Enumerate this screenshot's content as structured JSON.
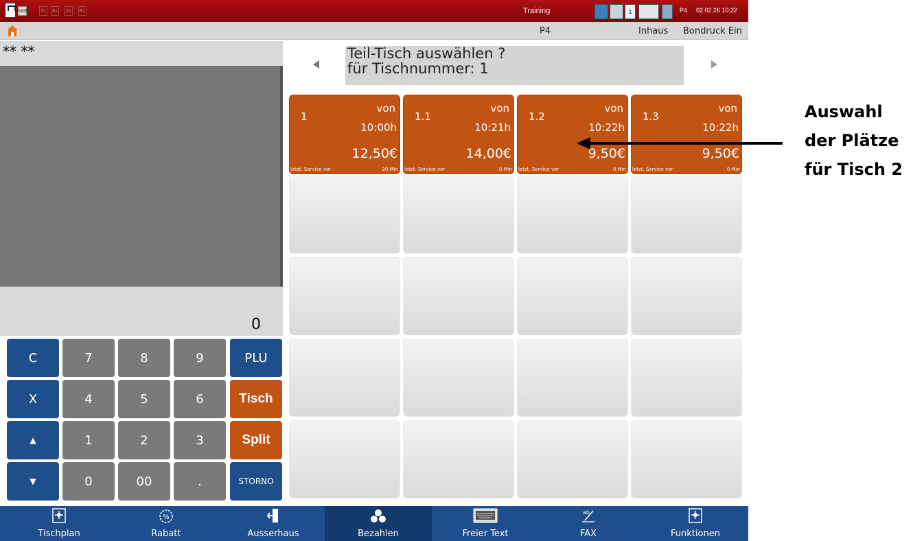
{
  "topbar": {
    "mini_tabs": [
      "MGR",
      "S1",
      "B1",
      "D1",
      "R1"
    ],
    "training": "Training",
    "status_icons": [
      "network-icon",
      "printer-icon",
      "window-1-icon",
      "keyboard-icon",
      "server-icon"
    ],
    "window_number": "1",
    "station": "P4",
    "datetime": "02.02.26 10:22",
    "color": "#a00c0c"
  },
  "subbar": {
    "station": "P4",
    "mode": "Inhaus",
    "bondruck": "Bondruck Ein"
  },
  "left": {
    "header": "**  **",
    "total": "0"
  },
  "keypad": {
    "rows": [
      [
        "C",
        "7",
        "8",
        "9",
        "PLU"
      ],
      [
        "X",
        "4",
        "5",
        "6",
        "Tisch"
      ],
      [
        "▲",
        "1",
        "2",
        "3",
        "Split"
      ],
      [
        "▼",
        "0",
        "00",
        ".",
        "STORNO"
      ]
    ]
  },
  "prompt": {
    "line1": "Teil-Tisch auswählen ?",
    "line2": "für Tischnummer:  1"
  },
  "tables": [
    {
      "number": "1",
      "von": "von",
      "time": "10:00h",
      "price": "12,50€",
      "service": "letzt. Service vor",
      "minutes": "20 Min"
    },
    {
      "number": "1.1",
      "von": "von",
      "time": "10:21h",
      "price": "14,00€",
      "service": "letzt. Service vor",
      "minutes": "0 Min"
    },
    {
      "number": "1.2",
      "von": "von",
      "time": "10:22h",
      "price": "9,50€",
      "service": "letzt. Service vor",
      "minutes": "0 Min"
    },
    {
      "number": "1.3",
      "von": "von",
      "time": "10:22h",
      "price": "9,50€",
      "service": "letzt. Service vor",
      "minutes": "0 Min"
    }
  ],
  "annotation": {
    "line1": "Auswahl",
    "line2": "der Plätze",
    "line3": "für Tisch 2"
  },
  "bottom": [
    {
      "label": "Tischplan",
      "icon": "gear-icon"
    },
    {
      "label": "Rabatt",
      "icon": "percent-icon"
    },
    {
      "label": "Ausserhaus",
      "icon": "exit-door-icon"
    },
    {
      "label": "Bezahlen",
      "icon": "coins-icon",
      "active": true
    },
    {
      "label": "Freier Text",
      "icon": "keyboard-icon"
    },
    {
      "label": "FAX",
      "icon": "fax-pen-icon"
    },
    {
      "label": "Funktionen",
      "icon": "gear-icon"
    }
  ],
  "colors": {
    "accent_orange": "#c15413",
    "accent_blue": "#1e4e8c",
    "key_grey": "#7a7a7a"
  }
}
